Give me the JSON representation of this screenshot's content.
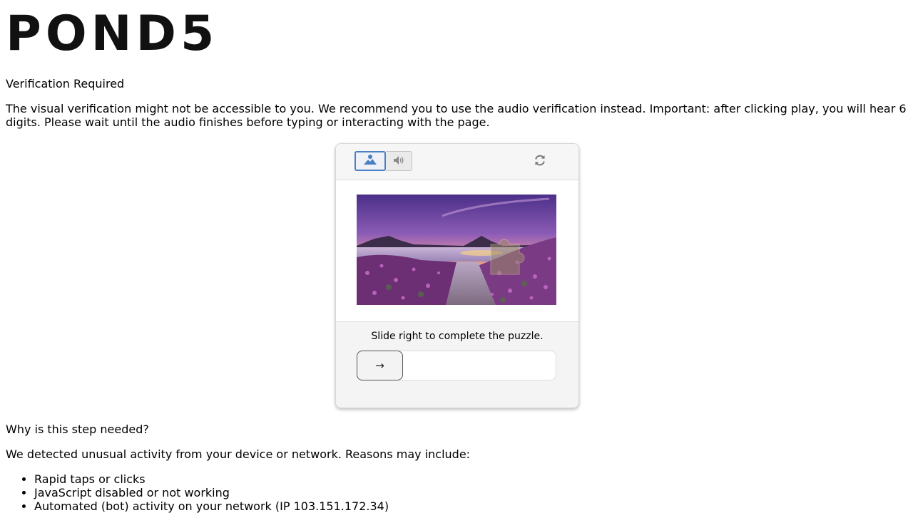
{
  "brand": {
    "logo_text": "POND5"
  },
  "verification": {
    "title": "Verification Required",
    "description": "The visual verification might not be accessible to you. We recommend you to use the audio verification instead. Important: after clicking play, you will hear 6 digits. Please wait until the audio finishes before typing or interacting with the page."
  },
  "captcha": {
    "modes": [
      {
        "name": "visual",
        "icon": "image-icon",
        "selected": true
      },
      {
        "name": "audio",
        "icon": "speaker-icon",
        "selected": false
      }
    ],
    "refresh_icon": "refresh-icon",
    "instruction": "Slide right to complete the puzzle.",
    "slider_handle_icon": "→",
    "slider_progress": 0,
    "colors": {
      "accent": "#4a7fc1",
      "sky_top": "#5a3f9a",
      "sunset": "#f0a060",
      "flowers": "#8a3f8e"
    }
  },
  "info": {
    "why_title": "Why is this step needed?",
    "detected_text": "We detected unusual activity from your device or network. Reasons may include:",
    "reasons": [
      "Rapid taps or clicks",
      "JavaScript disabled or not working",
      "Automated (bot) activity on your network (IP 103.151.172.34)"
    ]
  }
}
